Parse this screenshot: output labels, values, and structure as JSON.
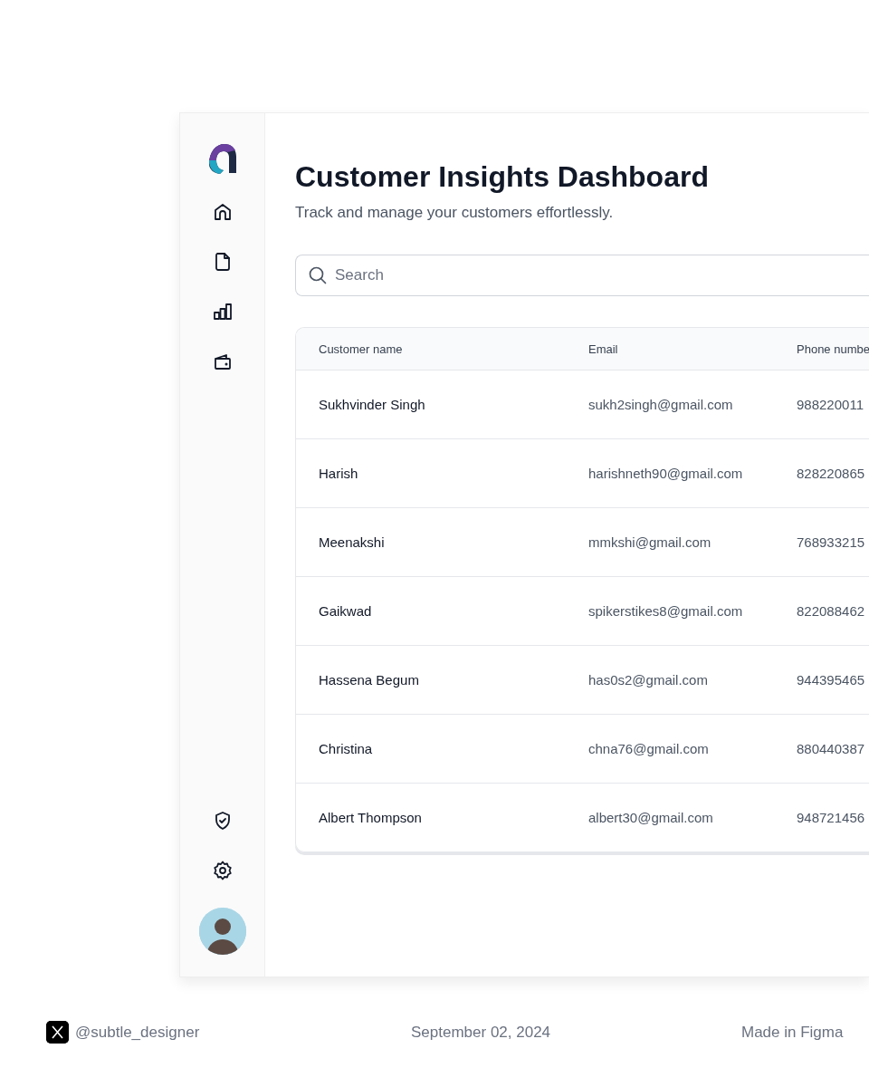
{
  "dashboard": {
    "title": "Customer Insights Dashboard",
    "subtitle": "Track and manage your customers effortlessly.",
    "search": {
      "placeholder": "Search"
    },
    "table": {
      "columns": [
        "Customer name",
        "Email",
        "Phone numbe"
      ],
      "rows": [
        [
          "Sukhvinder Singh",
          "sukh2singh@gmail.com",
          "988220011"
        ],
        [
          "Harish",
          "harishneth90@gmail.com",
          "828220865"
        ],
        [
          "Meenakshi",
          "mmkshi@gmail.com",
          "768933215"
        ],
        [
          "Gaikwad",
          "spikerstikes8@gmail.com",
          "822088462"
        ],
        [
          "Hassena Begum",
          "has0s2@gmail.com",
          "944395465"
        ],
        [
          "Christina",
          "chna76@gmail.com",
          "880440387"
        ],
        [
          "Albert Thompson",
          "albert30@gmail.com",
          "948721456"
        ]
      ]
    }
  },
  "footer": {
    "handle": "@subtle_designer",
    "date": "September 02, 2024",
    "credit": "Made in Figma"
  }
}
